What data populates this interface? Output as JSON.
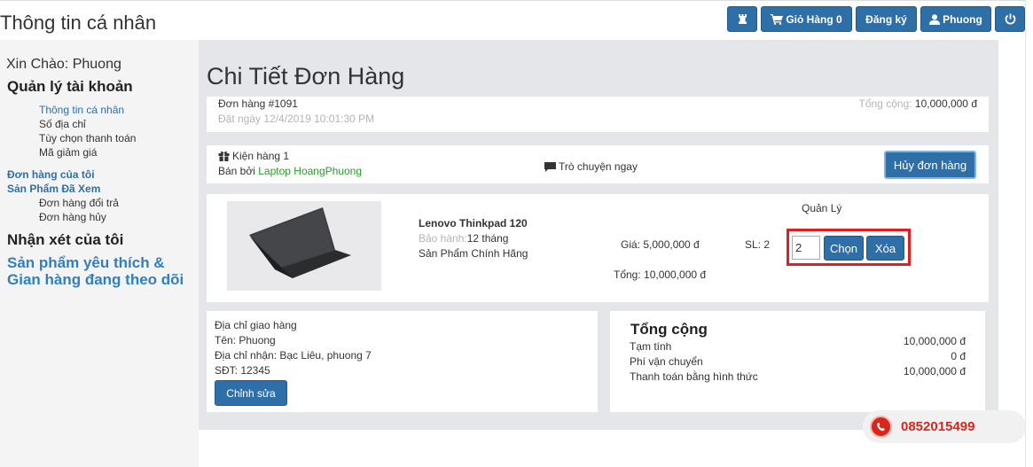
{
  "header": {
    "page_title": "Thông tin cá nhân",
    "buttons": {
      "cart": "Giỏ Hàng 0",
      "register": "Đăng ký",
      "user": "Phuong"
    }
  },
  "sidebar": {
    "greeting": "Xin Chào: Phuong",
    "account_title": "Quản lý tài khoản",
    "account_items": [
      "Thông tin cá nhân",
      "Số địa chỉ",
      "Tùy chọn thanh toán",
      "Mã giảm giá"
    ],
    "orders_title": "Đơn hàng của tôi",
    "viewed_title": "Sản Phẩm Đã Xem",
    "order_items": [
      "Đơn hàng đổi trả",
      "Đơn hàng hủy"
    ],
    "reviews_title": "Nhận xét của tôi",
    "favorites_line1": "Sản phẩm yêu thích &",
    "favorites_line2": "Gian hàng đang theo dõi"
  },
  "main": {
    "title": "Chi Tiết Đơn Hàng",
    "order": {
      "number": "Đơn hàng #1091",
      "date": "Đặt ngày 12/4/2019 10:01:30 PM",
      "total_label": "Tổng cộng:",
      "total_value": "10,000,000 đ"
    },
    "package": {
      "label": "Kiện hàng 1",
      "seller_prefix": "Bán bởi",
      "seller": "Laptop HoangPhuong",
      "chat": "Trò chuyện ngay",
      "cancel_button": "Hủy đơn hàng"
    },
    "item": {
      "name": "Lenovo Thinkpad 120",
      "warranty_label": "Bảo hành:",
      "warranty_value": "12 tháng",
      "authentic": "Sản Phẩm Chính Hãng",
      "price": "Giá: 5,000,000 đ",
      "qty": "SL: 2",
      "subtotal": "Tổng: 10,000,000 đ",
      "manage_label": "Quản Lý",
      "qty_input": "2",
      "choose_button": "Chọn",
      "delete_button": "Xóa"
    },
    "shipping": {
      "title": "Địa chỉ giao hàng",
      "name": "Tên: Phuong",
      "address": "Địa chỉ nhận: Bạc Liêu, phuong 7",
      "phone": "SĐT: 12345",
      "edit_button": "Chỉnh sửa"
    },
    "summary": {
      "title": "Tổng cộng",
      "rows": [
        {
          "label": "Tạm tính",
          "value": "10,000,000 đ"
        },
        {
          "label": "Phí vận chuyển",
          "value": "0 đ"
        },
        {
          "label": "Thanh toán bằng hình thức",
          "value": "10,000,000 đ"
        }
      ]
    }
  },
  "hotline": "0852015499",
  "colors": {
    "primary": "#2f6fa8",
    "link_blue": "#2f7fc1",
    "seller_green": "#2a9a2a",
    "highlight_red": "#e02020",
    "hotline_red": "#d9261c"
  }
}
